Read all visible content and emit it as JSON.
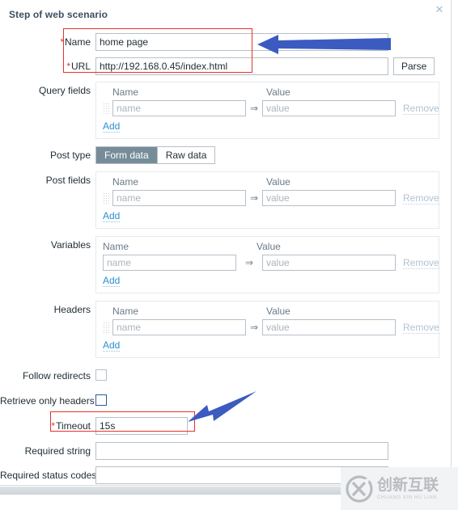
{
  "dialog": {
    "title": "Step of web scenario",
    "close_icon": "close-icon"
  },
  "fields": {
    "name": {
      "label": "Name",
      "value": "home page",
      "required": true
    },
    "url": {
      "label": "URL",
      "value": "http://192.168.0.45/index.html",
      "required": true,
      "parse_button": "Parse"
    },
    "query_fields": {
      "label": "Query fields"
    },
    "post_type": {
      "label": "Post type",
      "options": [
        "Form data",
        "Raw data"
      ],
      "selected": "Form data"
    },
    "post_fields": {
      "label": "Post fields"
    },
    "variables": {
      "label": "Variables"
    },
    "headers": {
      "label": "Headers"
    },
    "follow_redirects": {
      "label": "Follow redirects",
      "checked": false
    },
    "retrieve_only_headers": {
      "label": "Retrieve only headers",
      "checked": false
    },
    "timeout": {
      "label": "Timeout",
      "value": "15s",
      "required": true
    },
    "required_string": {
      "label": "Required string",
      "value": ""
    },
    "required_status_codes": {
      "label": "Required status codes",
      "value": ""
    }
  },
  "kv_common": {
    "header_name": "Name",
    "header_value": "Value",
    "name_placeholder": "name",
    "value_placeholder": "value",
    "separator": "⇒",
    "remove_label": "Remove",
    "add_label": "Add"
  },
  "annotations": {
    "highlight_color": "#e8312a",
    "arrow_color": "#3b5bc0",
    "arrow_1_target": "name-url-group",
    "arrow_2_target": "timeout-field"
  },
  "watermark": {
    "cn_text": "创新互联",
    "en_text": "CHUANG XIN HU LIAN",
    "logo_letter": "X"
  }
}
